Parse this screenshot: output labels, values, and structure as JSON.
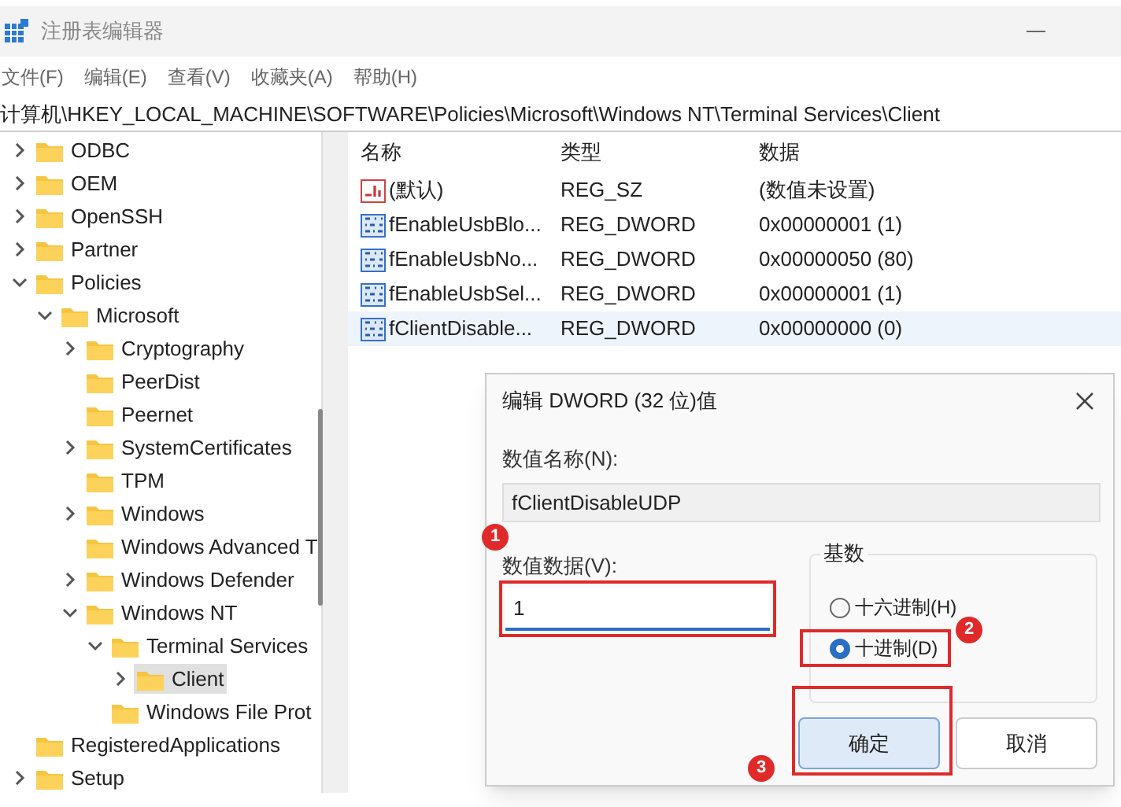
{
  "window": {
    "title": "注册表编辑器"
  },
  "menu": [
    "文件(F)",
    "编辑(E)",
    "查看(V)",
    "收藏夹(A)",
    "帮助(H)"
  ],
  "address": "计算机\\HKEY_LOCAL_MACHINE\\SOFTWARE\\Policies\\Microsoft\\Windows NT\\Terminal Services\\Client",
  "tree": [
    {
      "label": "ODBC",
      "expanded": false,
      "selected": false
    },
    {
      "label": "OEM",
      "expanded": false,
      "selected": false
    },
    {
      "label": "OpenSSH",
      "expanded": false,
      "selected": false
    },
    {
      "label": "Partner",
      "expanded": false,
      "selected": false
    },
    {
      "label": "Policies",
      "expanded": true,
      "selected": false,
      "children": [
        {
          "label": "Microsoft",
          "expanded": true,
          "selected": false,
          "children": [
            {
              "label": "Cryptography",
              "expanded": false,
              "selected": false
            },
            {
              "label": "PeerDist",
              "selected": false
            },
            {
              "label": "Peernet",
              "selected": false
            },
            {
              "label": "SystemCertificates",
              "expanded": false,
              "selected": false
            },
            {
              "label": "TPM",
              "selected": false
            },
            {
              "label": "Windows",
              "expanded": false,
              "selected": false
            },
            {
              "label": "Windows Advanced T",
              "selected": false
            },
            {
              "label": "Windows Defender",
              "expanded": false,
              "selected": false
            },
            {
              "label": "Windows NT",
              "expanded": true,
              "selected": false,
              "children": [
                {
                  "label": "Terminal Services",
                  "expanded": true,
                  "selected": false,
                  "children": [
                    {
                      "label": "Client",
                      "expanded": false,
                      "selected": true
                    }
                  ]
                },
                {
                  "label": "Windows File Prot",
                  "selected": false
                }
              ]
            }
          ]
        }
      ]
    },
    {
      "label": "RegisteredApplications",
      "selected": false
    },
    {
      "label": "Setup",
      "expanded": false,
      "selected": false
    }
  ],
  "list": {
    "columns": [
      "名称",
      "类型",
      "数据"
    ],
    "rows": [
      {
        "kind": "string",
        "name": "(默认)",
        "type": "REG_SZ",
        "data": "(数值未设置)",
        "selected": false
      },
      {
        "kind": "dword",
        "name": "fEnableUsbBlo...",
        "type": "REG_DWORD",
        "data": "0x00000001 (1)",
        "selected": false
      },
      {
        "kind": "dword",
        "name": "fEnableUsbNo...",
        "type": "REG_DWORD",
        "data": "0x00000050 (80)",
        "selected": false
      },
      {
        "kind": "dword",
        "name": "fEnableUsbSel...",
        "type": "REG_DWORD",
        "data": "0x00000001 (1)",
        "selected": false
      },
      {
        "kind": "dword",
        "name": "fClientDisable...",
        "type": "REG_DWORD",
        "data": "0x00000000 (0)",
        "selected": true
      }
    ]
  },
  "dialog": {
    "title": "编辑 DWORD (32 位)值",
    "name_label": "数值名称(N):",
    "name_value": "fClientDisableUDP",
    "data_label": "数值数据(V):",
    "data_value": "1",
    "base_label": "基数",
    "radios": [
      {
        "label": "十六进制(H)",
        "selected": false
      },
      {
        "label": "十进制(D)",
        "selected": true
      }
    ],
    "buttons": [
      {
        "label": "确定",
        "default": true
      },
      {
        "label": "取消",
        "default": false
      }
    ]
  },
  "callouts": [
    "1",
    "2",
    "3"
  ]
}
